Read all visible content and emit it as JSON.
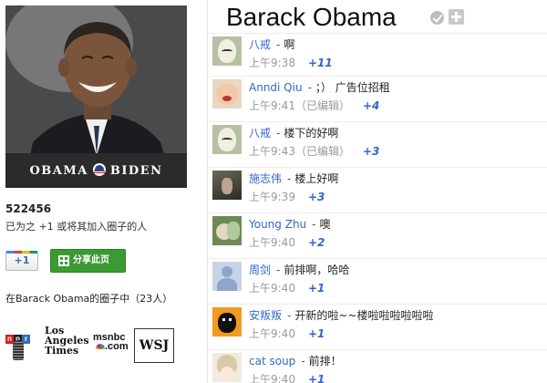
{
  "profile": {
    "name": "Barack Obama",
    "banner_left": "OBAMA",
    "banner_right": "BIDEN",
    "plus_count": "522456",
    "plus_desc": "已为之 +1 或将其加入圈子的人",
    "plus_button": "+1",
    "share_button": "分享此页",
    "circles_text": "在Barack Obama的圈子中（23人）"
  },
  "logos": {
    "npr": [
      "n",
      "p",
      "r"
    ],
    "latimes": [
      "Los",
      "Angeles",
      "Times"
    ],
    "msnbc": [
      "msnbc",
      ".com"
    ],
    "wsj": "WSJ"
  },
  "icons": {
    "verified": "check-circle-icon",
    "add": "add-to-circle-icon"
  },
  "comments": [
    {
      "author": "八戒",
      "text": "啊",
      "time": "上午9:38",
      "edited": "",
      "plus": "+11",
      "avatar": "mask"
    },
    {
      "author": "Anndi Qiu",
      "text": "；） 广告位招租",
      "time": "上午9:41",
      "edited": "（已编辑）",
      "plus": "+4",
      "avatar": "baby"
    },
    {
      "author": "八戒",
      "text": "楼下的好啊",
      "time": "上午9:43",
      "edited": "（已编辑）",
      "plus": "+3",
      "avatar": "mask"
    },
    {
      "author": "施志伟",
      "text": "楼上好啊",
      "time": "上午9:39",
      "edited": "",
      "plus": "+3",
      "avatar": "dark"
    },
    {
      "author": "Young Zhu",
      "text": "噢",
      "time": "上午9:40",
      "edited": "",
      "plus": "+2",
      "avatar": "young"
    },
    {
      "author": "周剑",
      "text": "前排啊，哈哈",
      "time": "上午9:40",
      "edited": "",
      "plus": "+1",
      "avatar": "silhouette"
    },
    {
      "author": "安叛叛",
      "text": "开新的啦~~楼啦啦啦啦啦啦",
      "time": "上午9:40",
      "edited": "",
      "plus": "+1",
      "avatar": "orange"
    },
    {
      "author": "cat soup",
      "text": "前排！",
      "time": "上午9:40",
      "edited": "",
      "plus": "+1",
      "avatar": "anime"
    }
  ]
}
